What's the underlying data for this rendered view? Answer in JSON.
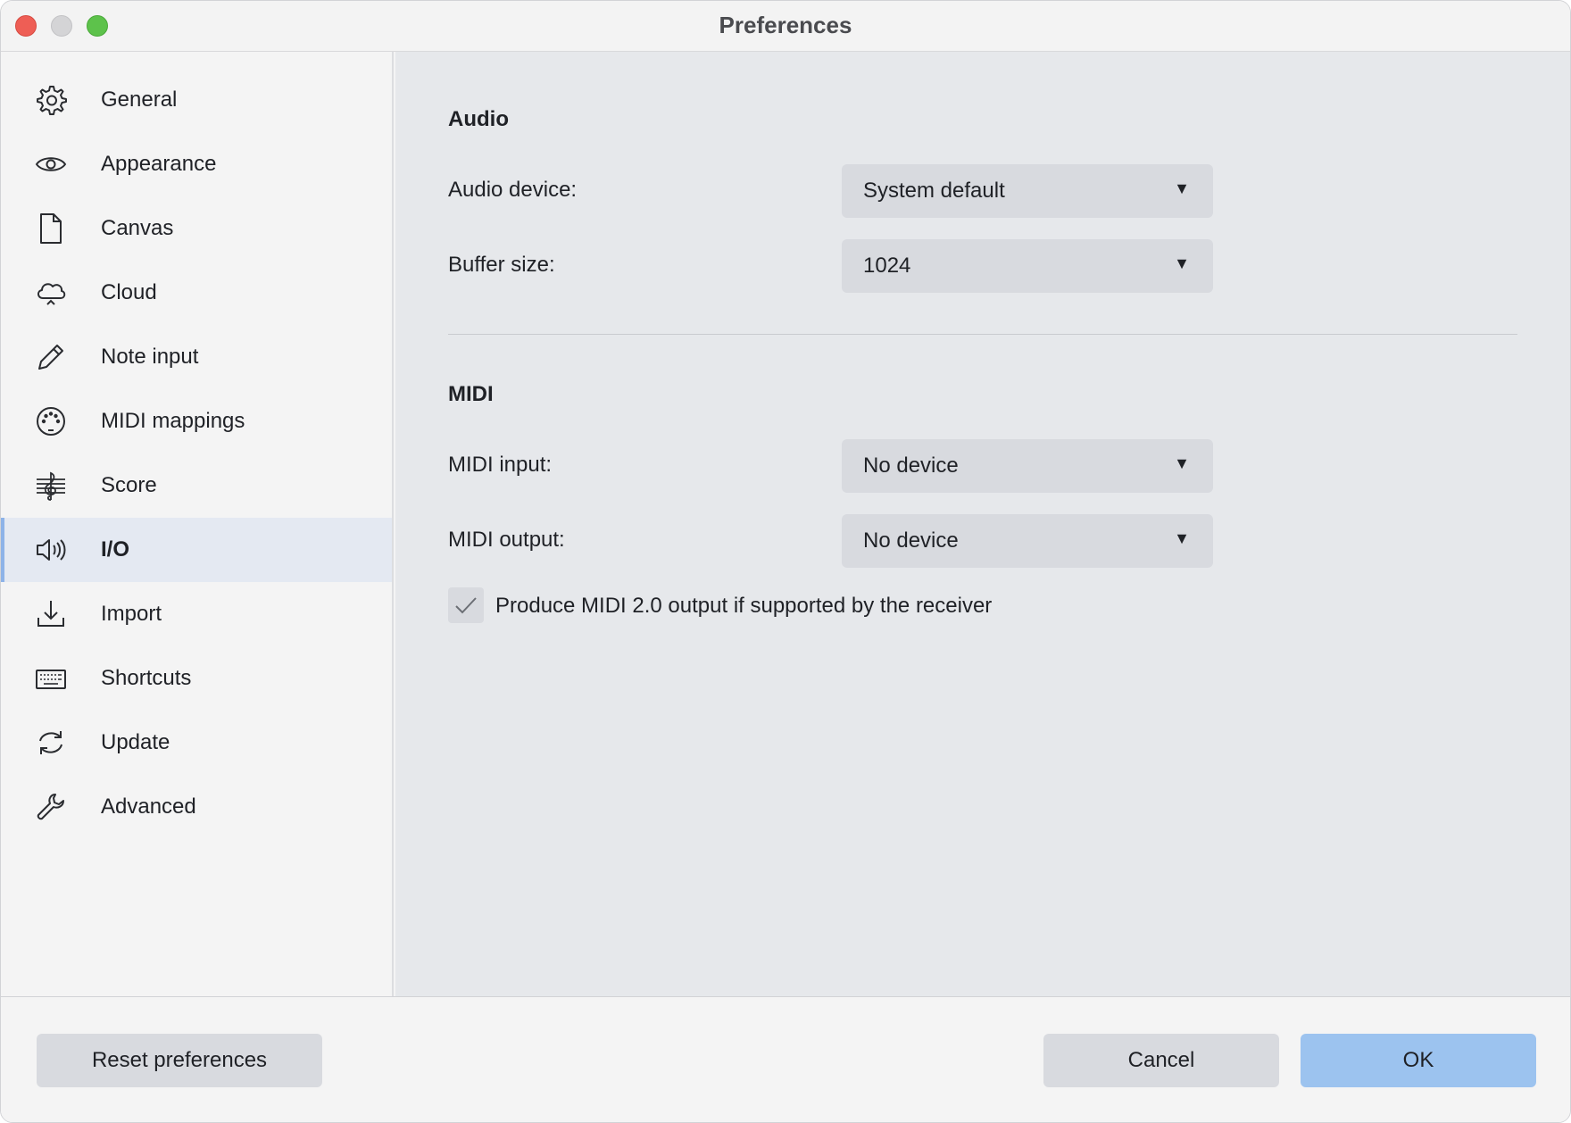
{
  "window": {
    "title": "Preferences"
  },
  "sidebar": {
    "items": [
      {
        "label": "General",
        "icon": "gear-icon"
      },
      {
        "label": "Appearance",
        "icon": "eye-icon"
      },
      {
        "label": "Canvas",
        "icon": "document-icon"
      },
      {
        "label": "Cloud",
        "icon": "cloud-icon"
      },
      {
        "label": "Note input",
        "icon": "pencil-icon"
      },
      {
        "label": "MIDI mappings",
        "icon": "midi-port-icon"
      },
      {
        "label": "Score",
        "icon": "treble-clef-icon"
      },
      {
        "label": "I/O",
        "icon": "speaker-icon",
        "active": true
      },
      {
        "label": "Import",
        "icon": "download-icon"
      },
      {
        "label": "Shortcuts",
        "icon": "keyboard-icon"
      },
      {
        "label": "Update",
        "icon": "refresh-icon"
      },
      {
        "label": "Advanced",
        "icon": "wrench-icon"
      }
    ]
  },
  "audio": {
    "section_title": "Audio",
    "device_label": "Audio device:",
    "device_value": "System default",
    "buffer_label": "Buffer size:",
    "buffer_value": "1024"
  },
  "midi": {
    "section_title": "MIDI",
    "input_label": "MIDI input:",
    "input_value": "No device",
    "output_label": "MIDI output:",
    "output_value": "No device",
    "midi2_label": "Produce MIDI 2.0 output if supported by the receiver",
    "midi2_checked": true
  },
  "footer": {
    "reset_label": "Reset preferences",
    "cancel_label": "Cancel",
    "ok_label": "OK"
  },
  "colors": {
    "accent": "#8db3e8",
    "ok_button": "#9cc3ef",
    "close": "#ee5e55",
    "maximize": "#5dc24b"
  }
}
